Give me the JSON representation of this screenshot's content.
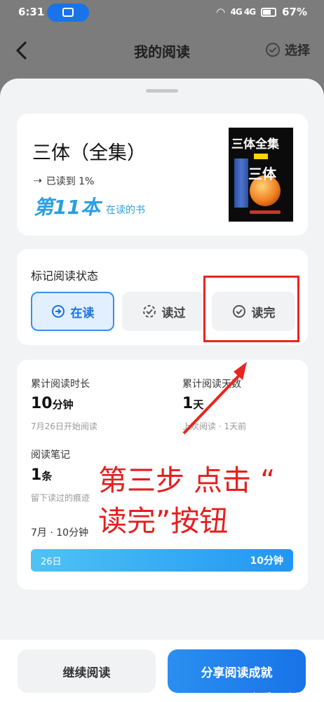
{
  "status_bar": {
    "time": "6:31",
    "signal_text": "4G 4G",
    "battery": "67%"
  },
  "nav": {
    "title": "我的阅读",
    "select_label": "选择"
  },
  "book": {
    "title": "三体（全集）",
    "progress_text": "已读到 1%",
    "nth_big": "第11本",
    "nth_small": "在读的书",
    "cover_title": "三体全集",
    "cover_series": "三体"
  },
  "reading_status": {
    "label": "标记阅读状态",
    "options": [
      {
        "label": "在读",
        "icon": "arrow-circle-icon",
        "active": true
      },
      {
        "label": "读过",
        "icon": "dashed-check-icon",
        "active": false
      },
      {
        "label": "读完",
        "icon": "check-circle-icon",
        "active": false
      }
    ]
  },
  "stats": {
    "duration_label": "累计阅读时长",
    "duration_value": "10",
    "duration_unit": "分钟",
    "duration_sub": "7月26日开始阅读",
    "days_label": "累计阅读天数",
    "days_value": "1",
    "days_unit": "天",
    "days_sub": "上次阅读 · 1天前",
    "notes_label": "阅读笔记",
    "notes_value": "1",
    "notes_unit": "条",
    "notes_sub": "留下读过的痕迹",
    "month_summary": "7月 · 10分钟",
    "bar_day": "26日",
    "bar_minutes": "10分钟"
  },
  "annotation": {
    "line1": "第三步 点击 “",
    "line2": "读完”按钮"
  },
  "bottom": {
    "continue_label": "继续阅读",
    "share_label": "分享阅读成就"
  },
  "watermark": "知乎 @尘埃cc",
  "colors": {
    "accent": "#1971e3",
    "annotation": "#e61e1e",
    "progress_blue": "#2b9fe0"
  }
}
